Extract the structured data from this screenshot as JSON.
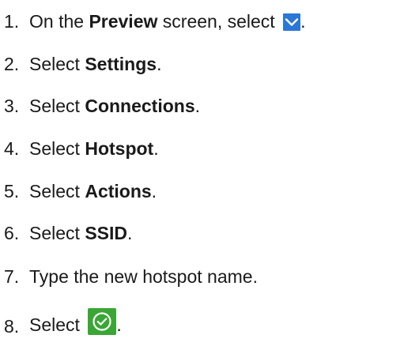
{
  "steps": [
    {
      "num": "1.",
      "pre": "On the ",
      "bold": "Preview",
      "post": " screen, select ",
      "icon": "chevron-down-icon",
      "end": "."
    },
    {
      "num": "2.",
      "pre": "Select ",
      "bold": "Settings",
      "post": "."
    },
    {
      "num": "3.",
      "pre": "Select ",
      "bold": "Connections",
      "post": "."
    },
    {
      "num": "4.",
      "pre": "Select ",
      "bold": "Hotspot",
      "post": "."
    },
    {
      "num": "5.",
      "pre": "Select ",
      "bold": "Actions",
      "post": "."
    },
    {
      "num": "6.",
      "pre": "Select ",
      "bold": "SSID",
      "post": "."
    },
    {
      "num": "7.",
      "text": "Type the new hotspot name."
    },
    {
      "num": "8.",
      "pre": "Select ",
      "icon": "checkmark-circle-icon",
      "end": "."
    }
  ],
  "colors": {
    "chevron_icon_bg": "#2b77d6",
    "check_icon_bg": "#3aa635"
  }
}
